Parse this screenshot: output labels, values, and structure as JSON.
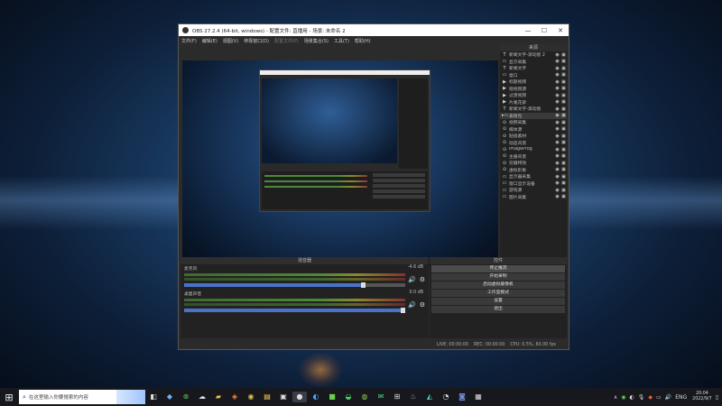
{
  "window": {
    "title": "OBS 27.2.4 (64-bit, windows) - 配置文件: 直播用 - 场景: 未命名 2",
    "controls": [
      "—",
      "☐",
      "✕"
    ]
  },
  "menu": [
    "文件(F)",
    "编辑(E)",
    "视图(V)",
    "停靠窗口(D)",
    "配置文件(P)",
    "场景集合(S)",
    "工具(T)",
    "帮助(H)"
  ],
  "sources": {
    "title": "来源",
    "items": [
      {
        "icon": "T",
        "name": "新闻文字-滚动窗 2"
      },
      {
        "icon": "▭",
        "name": "显示采集"
      },
      {
        "icon": "T",
        "name": "新闻文字"
      },
      {
        "icon": "▭",
        "name": "窗口"
      },
      {
        "icon": "▶",
        "name": "标题视频"
      },
      {
        "icon": "▶",
        "name": "短视频源"
      },
      {
        "icon": "▶",
        "name": "过渡视频"
      },
      {
        "icon": "▶",
        "name": "片尾花絮"
      },
      {
        "icon": "T",
        "name": "新闻文字-滚动窗"
      },
      {
        "icon": "▸▭",
        "name": "表情包"
      },
      {
        "icon": "⊙",
        "name": "视频采集"
      },
      {
        "icon": "⊙",
        "name": "媒体源"
      },
      {
        "icon": "⊙",
        "name": "贴纸素材"
      },
      {
        "icon": "⊙",
        "name": "动态背景"
      },
      {
        "icon": "⊙",
        "name": "ImageProg"
      },
      {
        "icon": "⊙",
        "name": "主播背景"
      },
      {
        "icon": "⊙",
        "name": "双摄特效"
      },
      {
        "icon": "⊙",
        "name": "虚拟形象"
      },
      {
        "icon": "▭",
        "name": "显示器采集"
      },
      {
        "icon": "▭",
        "name": "窗口显示设备"
      },
      {
        "icon": "▭",
        "name": "游戏源"
      },
      {
        "icon": "▭",
        "name": "图片采集"
      }
    ],
    "selected_index": 9,
    "toolbar": [
      "+",
      "−",
      "⚙",
      "∧",
      "∨"
    ]
  },
  "mixer": {
    "title": "混音器",
    "tracks": [
      {
        "name": "麦克风",
        "db": "-4.6 dB",
        "volume": 0.82
      },
      {
        "name": "桌面声音",
        "db": "0.0 dB",
        "volume": 1.0
      }
    ]
  },
  "controls": {
    "title": "控件",
    "buttons": [
      "停止推流",
      "开始录制",
      "启动虚拟摄像机",
      "工作室模式",
      "设置",
      "退出"
    ]
  },
  "statusbar": {
    "live": "LIVE: 00:00:00",
    "rec": "REC: 00:00:00",
    "cpu": "CPU: 0.5%, 60.00 fps"
  },
  "taskbar": {
    "search_placeholder": "在这里输入你要搜索的内容",
    "tray_lang": "ENG",
    "time": "20:04",
    "date": "2022/9/7"
  }
}
